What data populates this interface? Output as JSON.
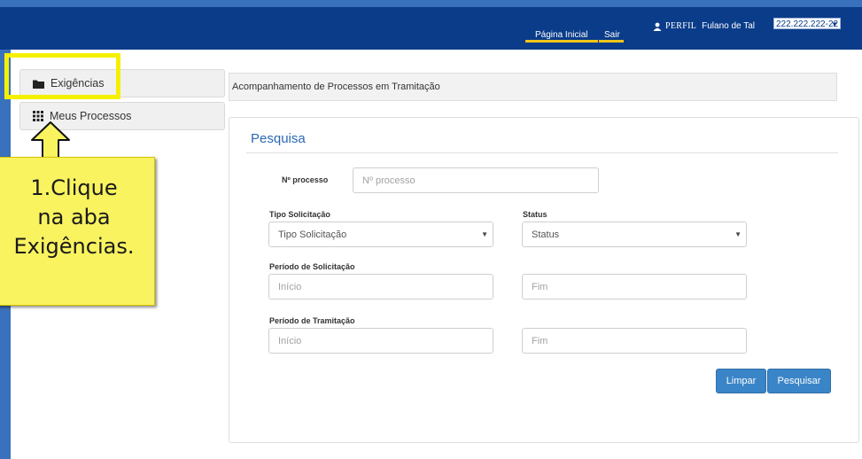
{
  "header": {
    "nav": [
      {
        "label": "Página Inicial"
      },
      {
        "label": "Sair"
      }
    ],
    "perfil_label": "PERFIL",
    "user_name": "Fulano de Tal",
    "user_id": "222.222.222-22",
    "colors": {
      "bar": "#0a3c8a",
      "accent": "#f2c41a"
    }
  },
  "sidebar": {
    "items": [
      {
        "label": "Exigências",
        "icon": "folder-icon"
      },
      {
        "label": "Meus Processos",
        "icon": "grid-icon"
      }
    ]
  },
  "breadcrumb": "Acompanhamento de Processos em Tramitação",
  "search": {
    "title": "Pesquisa",
    "processo_label": "Nº processo",
    "processo_placeholder": "Nº processo",
    "tipo_label": "Tipo Solicitação",
    "tipo_value": "Tipo Solicitação",
    "status_label": "Status",
    "status_value": "Status",
    "periodo_solic_label": "Período de Solicitação",
    "periodo_tram_label": "Período de Tramitação",
    "inicio_placeholder": "Início",
    "fim_placeholder": "Fim",
    "clear_label": "Limpar",
    "submit_label": "Pesquisar"
  },
  "annotation": {
    "lines": [
      "1.Clique",
      "na aba",
      "Exigências."
    ]
  }
}
